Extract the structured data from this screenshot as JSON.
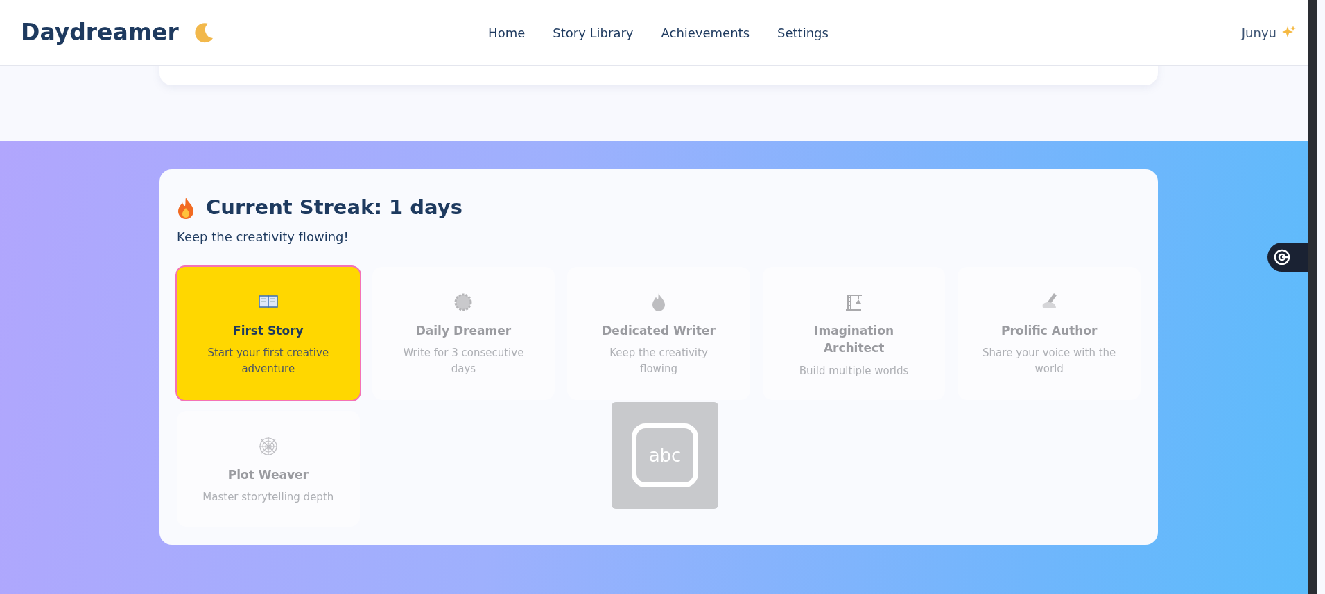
{
  "brand": {
    "name": "Daydreamer"
  },
  "nav": [
    {
      "label": "Home"
    },
    {
      "label": "Story Library"
    },
    {
      "label": "Achievements"
    },
    {
      "label": "Settings"
    }
  ],
  "user": {
    "name": "Junyu"
  },
  "streak": {
    "title": "Current Streak: 1 days",
    "subtitle": "Keep the creativity flowing!"
  },
  "achievements": [
    {
      "title": "First Story",
      "description": "Start your first creative adventure",
      "unlocked": true
    },
    {
      "title": "Daily Dreamer",
      "description": "Write for 3 consecutive days",
      "unlocked": false
    },
    {
      "title": "Dedicated Writer",
      "description": "Keep the creativity flowing",
      "unlocked": false
    },
    {
      "title": "Imagination Architect",
      "description": "Build multiple worlds",
      "unlocked": false
    },
    {
      "title": "Prolific Author",
      "description": "Share your voice with the world",
      "unlocked": false
    },
    {
      "title": "Plot Weaver",
      "description": "Master storytelling depth",
      "unlocked": false
    }
  ],
  "ime_indicator": {
    "label": "abc"
  }
}
